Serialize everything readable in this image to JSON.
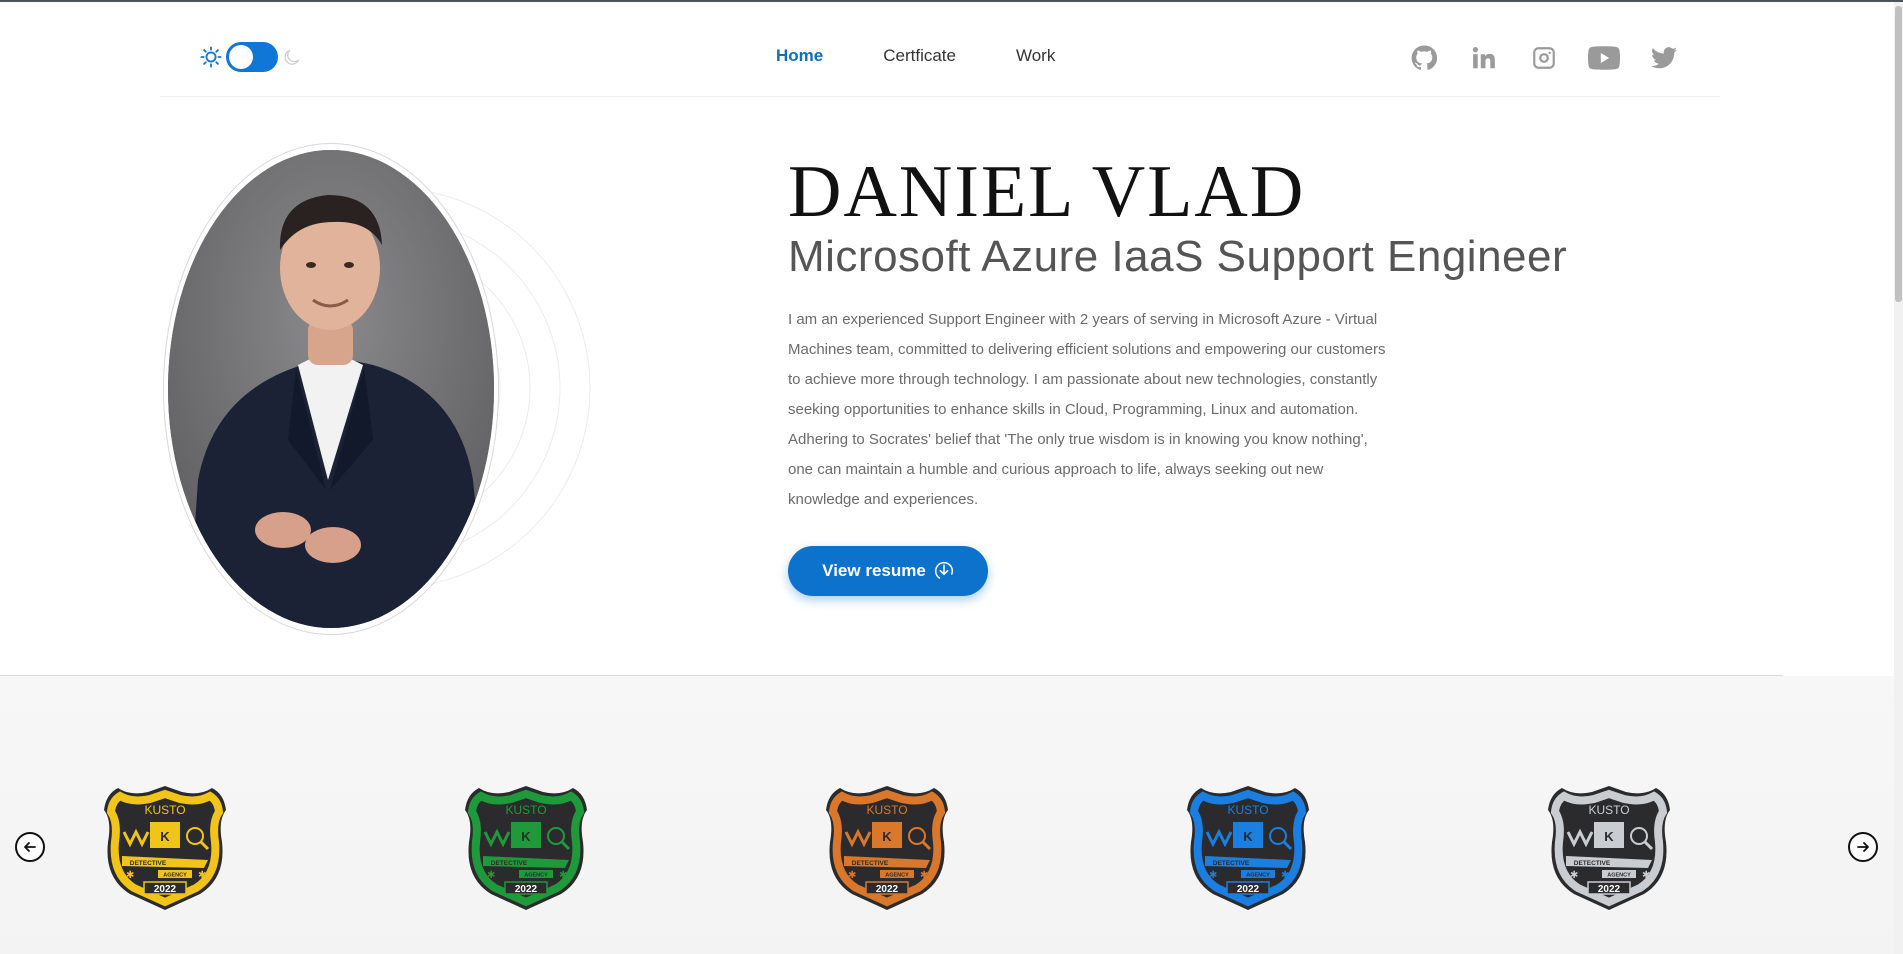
{
  "header": {
    "nav": [
      {
        "label": "Home",
        "active": true
      },
      {
        "label": "Certficate",
        "active": false
      },
      {
        "label": "Work",
        "active": false
      }
    ],
    "theme_toggle": {
      "left_icon": "sun-icon",
      "right_icon": "moon-icon",
      "state": "light"
    },
    "socials": [
      "github-icon",
      "linkedin-icon",
      "instagram-icon",
      "youtube-icon",
      "twitter-icon"
    ]
  },
  "hero": {
    "name": "DANIEL VLAD",
    "role": "Microsoft Azure IaaS Support Engineer",
    "bio": "I am an experienced Support Engineer with 2 years of serving in Microsoft Azure - Virtual Machines team, committed to delivering efficient solutions and empowering our customers to achieve more through technology. I am passionate about new technologies, constantly seeking opportunities to enhance skills in Cloud, Programming, Linux and automation. Adhering to Socrates' belief that 'The only true wisdom is in knowing you know nothing', one can maintain a humble and curious approach to life, always seeking out new knowledge and experiences.",
    "resume_button": "View resume"
  },
  "badges": [
    {
      "title": "KUSTO",
      "ribbon": "DETECTIVE",
      "sub": "AGENCY",
      "year": "2022",
      "color": "#f0c419"
    },
    {
      "title": "KUSTO",
      "ribbon": "DETECTIVE",
      "sub": "AGENCY",
      "year": "2022",
      "color": "#1e9a3a"
    },
    {
      "title": "KUSTO",
      "ribbon": "DETECTIVE",
      "sub": "AGENCY",
      "year": "2022",
      "color": "#d9782a"
    },
    {
      "title": "KUSTO",
      "ribbon": "DETECTIVE",
      "sub": "AGENCY",
      "year": "2022",
      "color": "#1a7fe0"
    },
    {
      "title": "KUSTO",
      "ribbon": "DETECTIVE",
      "sub": "AGENCY",
      "year": "2022",
      "color": "#c9cdd2"
    }
  ],
  "colors": {
    "accent": "#0c72cc",
    "nav_active": "#0c6fbf",
    "text_muted": "#6b6b6b"
  }
}
